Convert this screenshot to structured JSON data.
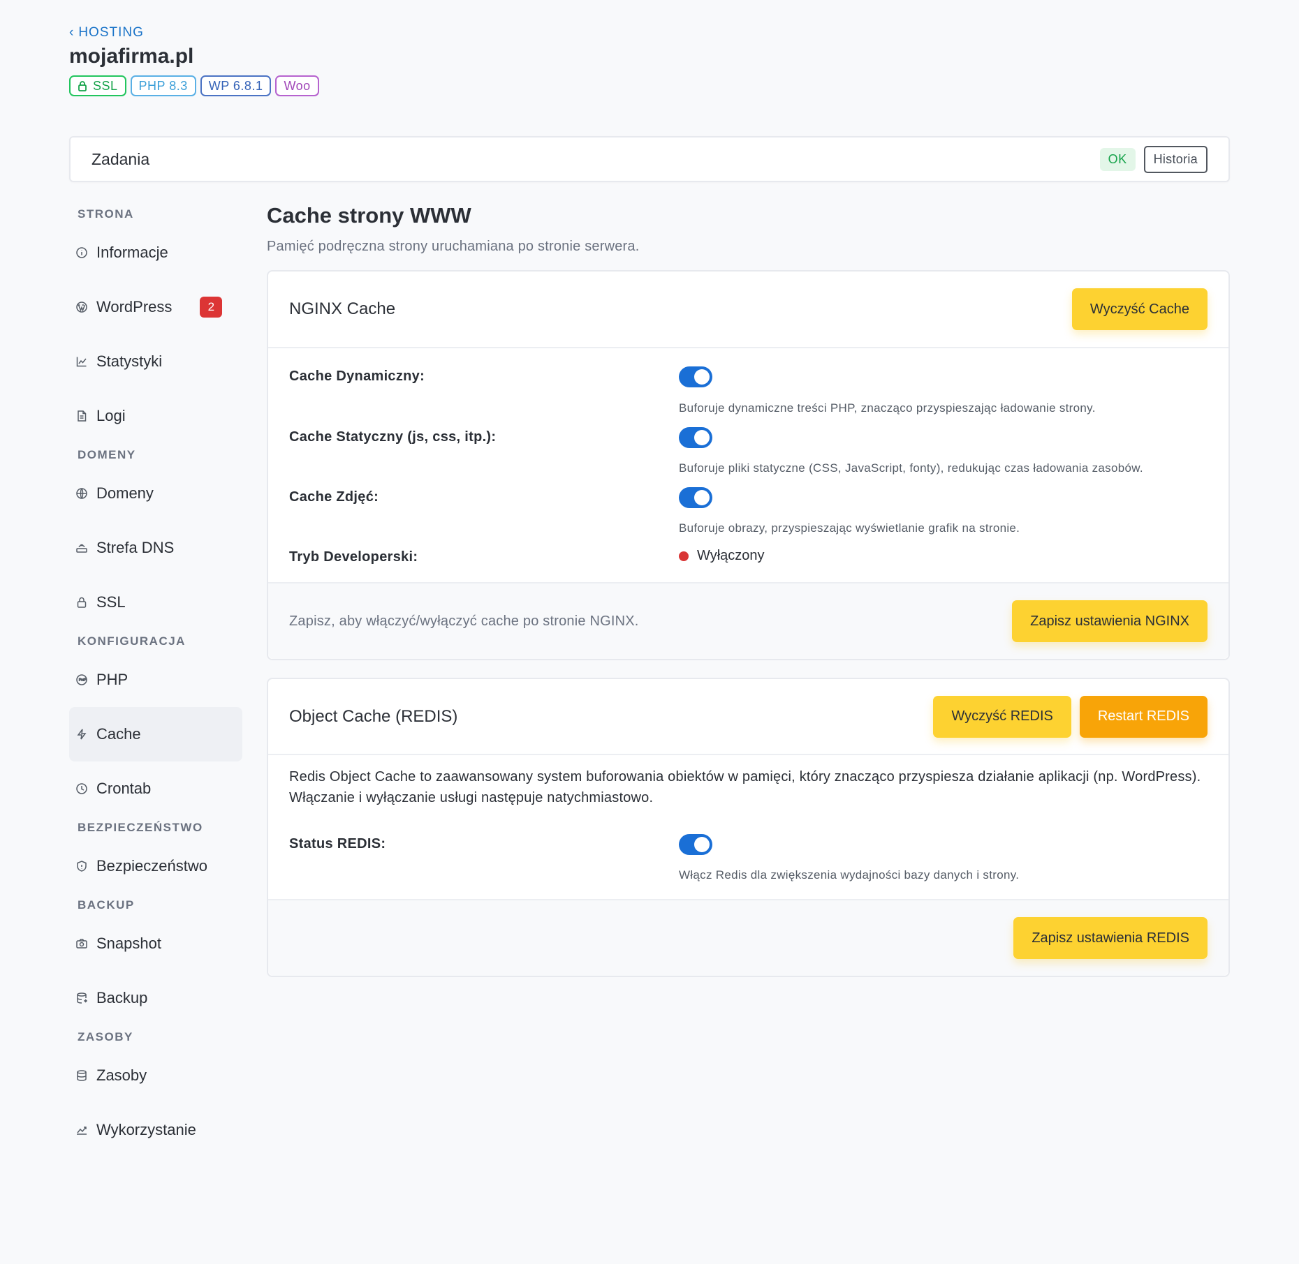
{
  "header": {
    "back_label": "HOSTING",
    "site": "mojafirma.pl",
    "badges": {
      "ssl": "SSL",
      "php": "PHP 8.3",
      "wp": "WP 6.8.1",
      "woo": "Woo"
    }
  },
  "tasks": {
    "title": "Zadania",
    "status": "OK",
    "history_label": "Historia"
  },
  "sidebar": {
    "strona": {
      "title": "STRONA",
      "informacje": "Informacje",
      "wordpress": "WordPress",
      "wordpress_count": "2",
      "statystyki": "Statystyki",
      "logi": "Logi"
    },
    "domeny": {
      "title": "DOMENY",
      "domeny": "Domeny",
      "dns": "Strefa DNS",
      "ssl": "SSL"
    },
    "konfiguracja": {
      "title": "KONFIGURACJA",
      "php": "PHP",
      "cache": "Cache",
      "crontab": "Crontab"
    },
    "bezpieczenstwo": {
      "title": "BEZPIECZEŃSTWO",
      "bezpieczenstwo": "Bezpieczeństwo"
    },
    "backup": {
      "title": "BACKUP",
      "snapshot": "Snapshot",
      "backup": "Backup"
    },
    "zasoby": {
      "title": "ZASOBY",
      "zasoby": "Zasoby",
      "wykorzystanie": "Wykorzystanie"
    }
  },
  "main": {
    "title": "Cache strony WWW",
    "subtitle": "Pamięć podręczna strony uruchamiana po stronie serwera."
  },
  "nginx": {
    "title": "NGINX Cache",
    "clear_label": "Wyczyść Cache",
    "dynamic": {
      "label": "Cache Dynamiczny:",
      "enabled": true,
      "desc": "Buforuje dynamiczne treści PHP, znacząco przyspieszając ładowanie strony."
    },
    "static": {
      "label": "Cache Statyczny (js, css, itp.):",
      "enabled": true,
      "desc": "Buforuje pliki statyczne (CSS, JavaScript, fonty), redukując czas ładowania zasobów."
    },
    "images": {
      "label": "Cache Zdjęć:",
      "enabled": true,
      "desc": "Buforuje obrazy, przyspieszając wyświetlanie grafik na stronie."
    },
    "dev": {
      "label": "Tryb Developerski:",
      "status": "Wyłączony",
      "status_color": "#d93636"
    },
    "footer_text": "Zapisz, aby włączyć/wyłączyć cache po stronie NGINX.",
    "save_label": "Zapisz ustawienia NGINX"
  },
  "redis": {
    "title": "Object Cache (REDIS)",
    "clear_label": "Wyczyść REDIS",
    "restart_label": "Restart REDIS",
    "description": "Redis Object Cache to zaawansowany system buforowania obiektów w pamięci, który znacząco przyspiesza działanie aplikacji (np. WordPress). Włączanie i wyłączanie usługi następuje natychmiastowo.",
    "status": {
      "label": "Status REDIS:",
      "enabled": true,
      "desc": "Włącz Redis dla zwiększenia wydajności bazy danych i strony."
    },
    "save_label": "Zapisz ustawienia REDIS"
  },
  "colors": {
    "accent": "#1a6fd6",
    "yellow": "#fdd231",
    "orange": "#f8a408",
    "danger": "#dc3535"
  }
}
